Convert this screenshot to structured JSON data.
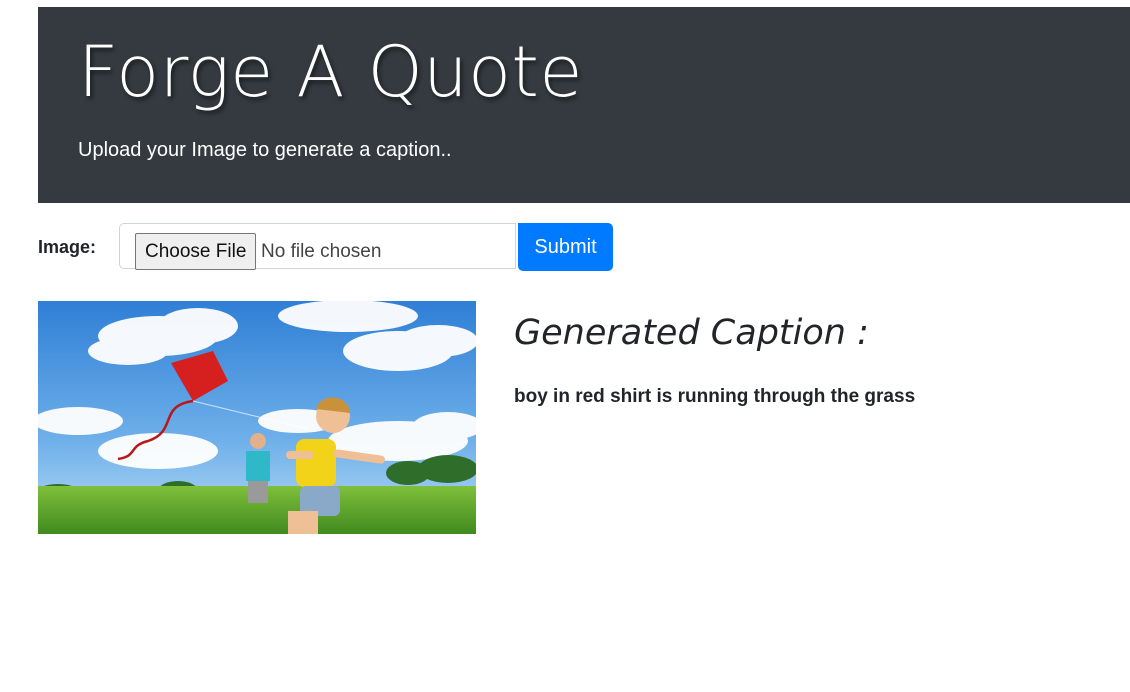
{
  "header": {
    "title": "Forge A Quote",
    "subtitle": "Upload your Image to generate a caption.."
  },
  "form": {
    "image_label": "Image:",
    "choose_file_label": "Choose File",
    "file_status": "No file chosen",
    "submit_label": "Submit"
  },
  "result": {
    "image_description": "uploaded-photo",
    "heading": "Generated Caption :",
    "caption": "boy in red shirt is running through the grass"
  },
  "colors": {
    "header_bg": "#343a40",
    "submit_bg": "#007bff",
    "text": "#212529"
  }
}
